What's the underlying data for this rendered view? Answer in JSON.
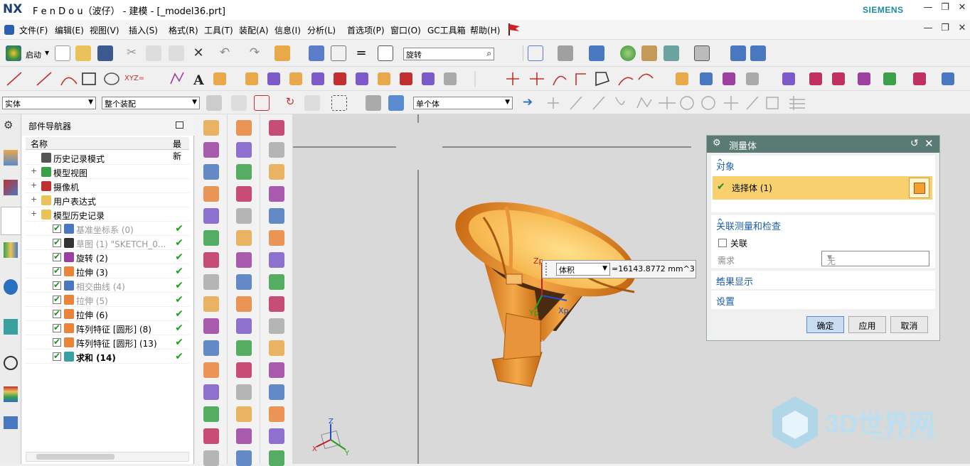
{
  "titlebar": {
    "logo": "NX",
    "title": "F e n D o u（波仔） - 建模 - [_model36.prt]",
    "brand": "SIEMENS"
  },
  "menu": [
    "文件(F)",
    "编辑(E)",
    "视图(V)",
    "插入(S)",
    "格式(R)",
    "工具(T)",
    "装配(A)",
    "信息(I)",
    "分析(L)",
    "首选项(P)",
    "窗口(O)",
    "GC工具箱",
    "帮助(H)"
  ],
  "toolbar": {
    "start_label": "启动",
    "command_search": "旋转",
    "filter_type": "实体",
    "filter_scope": "整个装配",
    "filter_body": "单个体"
  },
  "navigator": {
    "title": "部件导航器",
    "col_name": "名称",
    "col_latest": "最新",
    "items": [
      {
        "label": "历史记录模式",
        "indent": 0,
        "style": "normal"
      },
      {
        "label": "模型视图",
        "indent": 0,
        "style": "normal"
      },
      {
        "label": "摄像机",
        "indent": 0,
        "style": "normal"
      },
      {
        "label": "用户表达式",
        "indent": 0,
        "style": "normal"
      },
      {
        "label": "模型历史记录",
        "indent": 0,
        "style": "normal"
      },
      {
        "label": "基准坐标系 (0)",
        "indent": 1,
        "style": "grey"
      },
      {
        "label": "草图 (1) \"SKETCH_0...",
        "indent": 1,
        "style": "grey"
      },
      {
        "label": "旋转 (2)",
        "indent": 1,
        "style": "normal"
      },
      {
        "label": "拉伸 (3)",
        "indent": 1,
        "style": "normal"
      },
      {
        "label": "相交曲线 (4)",
        "indent": 1,
        "style": "grey"
      },
      {
        "label": "拉伸 (5)",
        "indent": 1,
        "style": "grey"
      },
      {
        "label": "拉伸 (6)",
        "indent": 1,
        "style": "normal"
      },
      {
        "label": "阵列特征 [圆形] (8)",
        "indent": 1,
        "style": "normal"
      },
      {
        "label": "阵列特征 [圆形] (13)",
        "indent": 1,
        "style": "normal"
      },
      {
        "label": "求和 (14)",
        "indent": 1,
        "style": "bold"
      }
    ]
  },
  "viewport": {
    "measure_type": "体积",
    "measure_value": "=16143.8772 mm^3",
    "axis_labels": {
      "xp": "Xp",
      "yp": "Yp",
      "zp": "Zp"
    },
    "triad": {
      "x": "X",
      "y": "Y",
      "z": "Z"
    }
  },
  "dialog": {
    "title": "测量体",
    "section_object": "对象",
    "select_body": "选择体 (1)",
    "section_assoc": "关联测量和检查",
    "assoc_label": "关联",
    "require_label": "需求",
    "require_value": "无",
    "section_results": "结果显示",
    "section_settings": "设置",
    "ok": "确定",
    "apply": "应用",
    "cancel": "取消"
  },
  "watermark": {
    "text": "3D世界网",
    "url": "WWW.3DSJW.COM"
  }
}
